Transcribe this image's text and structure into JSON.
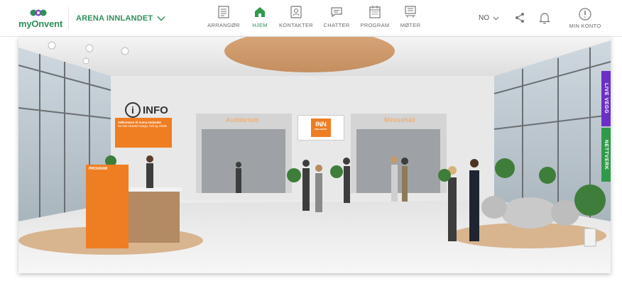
{
  "brand": {
    "name_prefix": "my",
    "name_suffix": "Onvent",
    "color": "#2f8f5b"
  },
  "event": {
    "name": "ARENA INNLANDET"
  },
  "nav": {
    "items": [
      {
        "id": "organizer",
        "label": "ARRANGØR",
        "icon": "organizer-icon",
        "active": false
      },
      {
        "id": "home",
        "label": "HJEM",
        "icon": "home-icon",
        "active": true
      },
      {
        "id": "contacts",
        "label": "KONTAKTER",
        "icon": "contacts-icon",
        "active": false
      },
      {
        "id": "chats",
        "label": "CHATTER",
        "icon": "chat-icon",
        "active": false
      },
      {
        "id": "program",
        "label": "PROGRAM",
        "icon": "calendar-icon",
        "active": false
      },
      {
        "id": "meetings",
        "label": "MØTER",
        "icon": "meeting-icon",
        "active": false
      }
    ]
  },
  "language": {
    "value": "NO"
  },
  "account": {
    "label": "MIN KONTO"
  },
  "scene": {
    "info_sign": "INFO",
    "info_screen_title": "Velkommen til Arena Innlandet",
    "info_screen_text": "Du kan besøke lounge, hall og chatte",
    "room_left": "Auditorium",
    "room_right": "Messehall",
    "inn_logo_line1": "INN",
    "inn_logo_line2": "INNLANDET",
    "program_title": "PROGRAM",
    "side_tab_purple": "LIVE VEGG",
    "side_tab_green": "NETTVERK"
  },
  "colors": {
    "accent": "#2f8f5b",
    "orange": "#ef7d22",
    "purple": "#6b2fc7",
    "green_tab": "#2f9a4a"
  }
}
